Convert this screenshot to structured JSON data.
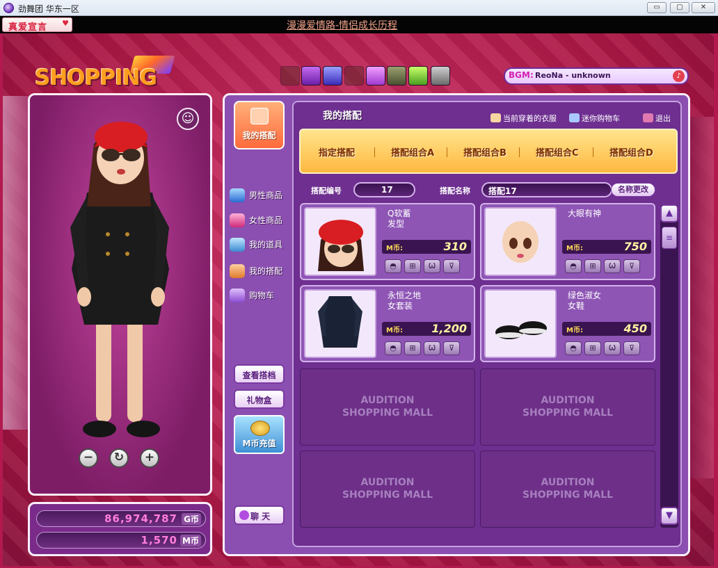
{
  "window": {
    "title": "劲舞团 华东一区",
    "buttons": {
      "minimize": "▭",
      "maximize": "▢",
      "close": "✕"
    }
  },
  "topbar": {
    "love_button": "真爱宣言",
    "marquee": "漫漫爱情路-情侣成长历程"
  },
  "logo": {
    "text": "SHOPPING MALL"
  },
  "bgm": {
    "label": "BGM:",
    "song": "ReoNa - unknown"
  },
  "money": {
    "gold": {
      "value": "86,974,787",
      "unit": "G币"
    },
    "mcoin": {
      "value": "1,570",
      "unit": "M币"
    }
  },
  "sidebar": {
    "active": "我的搭配",
    "items": [
      {
        "label": "男性商品"
      },
      {
        "label": "女性商品"
      },
      {
        "label": "我的道具"
      },
      {
        "label": "我的搭配"
      },
      {
        "label": "购物车"
      }
    ],
    "buttons": {
      "view_outfit": "查看搭档",
      "gift_box": "礼物盒",
      "recharge": "M币充值",
      "chat": "聊 天"
    }
  },
  "content": {
    "title": "我的搭配",
    "links": {
      "current_clothes": "当前穿着的衣服",
      "mini_cart": "迷你购物车",
      "exit": "退出"
    },
    "tabs": [
      "指定搭配",
      "搭配组合A",
      "搭配组合B",
      "搭配组合C",
      "搭配组合D"
    ],
    "outfit_number_label": "搭配编号",
    "outfit_number": "17",
    "outfit_name_label": "搭配名称",
    "outfit_name": "搭配17",
    "rename_button": "名称更改",
    "price_unit": "M币:",
    "items": [
      {
        "name": "Q软蓄\n发型",
        "price": "310"
      },
      {
        "name": "大眼有神",
        "price": "750"
      },
      {
        "name": "永恒之地\n女套装",
        "price": "1,200"
      },
      {
        "name": "绿色淑女\n女鞋",
        "price": "450"
      }
    ],
    "empty_slot": "AUDITION\nSHOPPING MALL"
  },
  "colors": {
    "background": "#b2194f",
    "panel": "#8a4fb0",
    "tab_bar": "#ffb840",
    "price_text": "#fff4a3",
    "money_text": "#ff7edb"
  }
}
